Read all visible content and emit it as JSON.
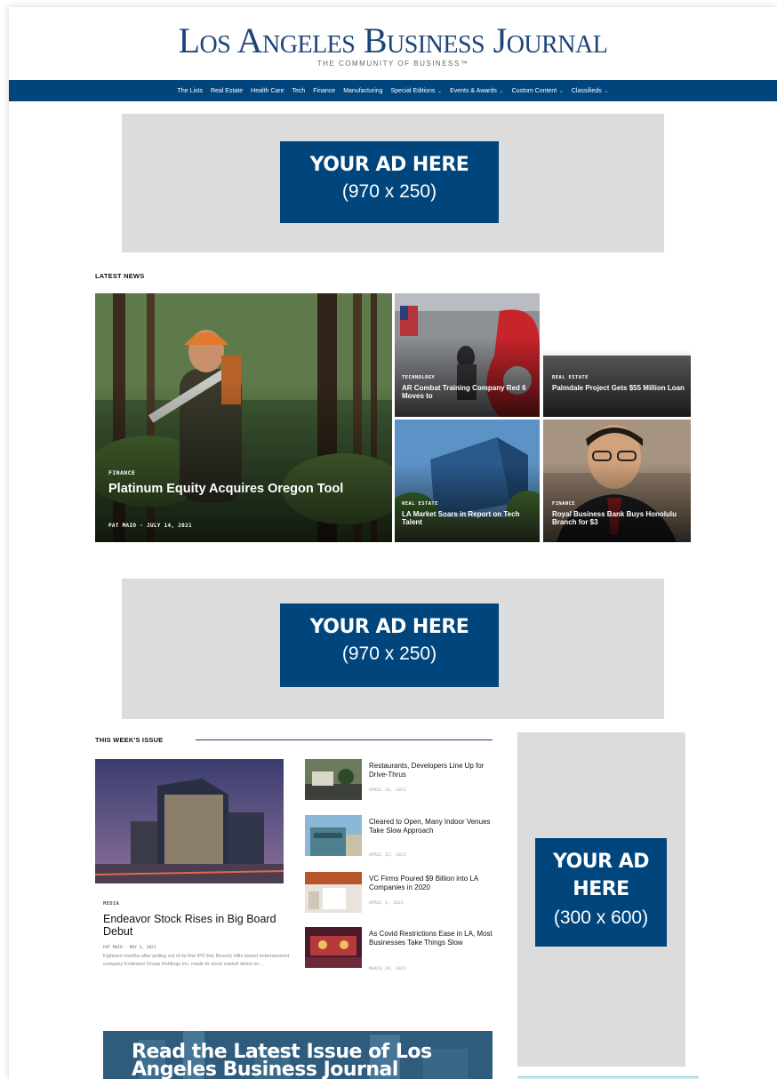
{
  "masthead": {
    "logo": "Los Angeles Business Journal",
    "tagline": "THE COMMUNITY OF BUSINESS™"
  },
  "nav": [
    {
      "label": "The Lists",
      "dropdown": false
    },
    {
      "label": "Real Estate",
      "dropdown": false
    },
    {
      "label": "Health Care",
      "dropdown": false
    },
    {
      "label": "Tech",
      "dropdown": false
    },
    {
      "label": "Finance",
      "dropdown": false
    },
    {
      "label": "Manufacturing",
      "dropdown": false
    },
    {
      "label": "Special Editions",
      "dropdown": true
    },
    {
      "label": "Events & Awards",
      "dropdown": true
    },
    {
      "label": "Custom Content",
      "dropdown": true
    },
    {
      "label": "Classifieds",
      "dropdown": true
    }
  ],
  "ads": {
    "top": {
      "title": "YOUR AD HERE",
      "size": "(970 x 250)"
    },
    "middle": {
      "title": "YOUR AD HERE",
      "size": "(970 x 250)"
    },
    "sidebar": {
      "title_line1": "YOUR AD",
      "title_line2": "HERE",
      "size": "(300 x 600)"
    }
  },
  "latest_news": {
    "label": "LATEST NEWS",
    "main": {
      "category": "FINANCE",
      "title": "Platinum Equity Acquires Oregon Tool",
      "meta": "PAT MAIO - JULY 14, 2021"
    },
    "tiles": [
      {
        "category": "TECHNOLOGY",
        "title": "AR Combat Training Company Red 6 Moves to"
      },
      {
        "category": "REAL ESTATE",
        "title": "Palmdale Project Gets $55 Million Loan"
      },
      {
        "category": "REAL ESTATE",
        "title": "LA Market Soars in Report on Tech Talent"
      },
      {
        "category": "FINANCE",
        "title": "Royal Business Bank Buys Honolulu Branch for $3"
      }
    ]
  },
  "this_weeks_issue": {
    "label": "THIS WEEK'S ISSUE",
    "feature": {
      "category": "MEDIA",
      "title": "Endeavor Stock Rises in Big Board Debut",
      "meta": "PAT MAIO - MAY 3, 2021",
      "excerpt": "Eighteen months after pulling out of its first IPO bid, Beverly Hills-based entertainment company Endeavor Group Holdings Inc. made its stock market debut on..."
    },
    "items": [
      {
        "title": "Restaurants, Developers Line Up for Drive-Thrus",
        "date": "APRIL 26, 2021"
      },
      {
        "title": "Cleared to Open, Many Indoor Venues Take Slow Approach",
        "date": "APRIL 12, 2021"
      },
      {
        "title": "VC Firms Poured $9 Billion into LA Companies in 2020",
        "date": "APRIL 5, 2021"
      },
      {
        "title": "As Covid Restrictions Ease in LA, Most Businesses Take Things Slow",
        "date": "MARCH 29, 2021"
      }
    ]
  },
  "promo": {
    "text": "Read the Latest Issue of Los Angeles Business Journal"
  },
  "colors": {
    "brand": "#00457c",
    "logo": "#1c4479",
    "ad_bg": "#dcdcdc"
  }
}
